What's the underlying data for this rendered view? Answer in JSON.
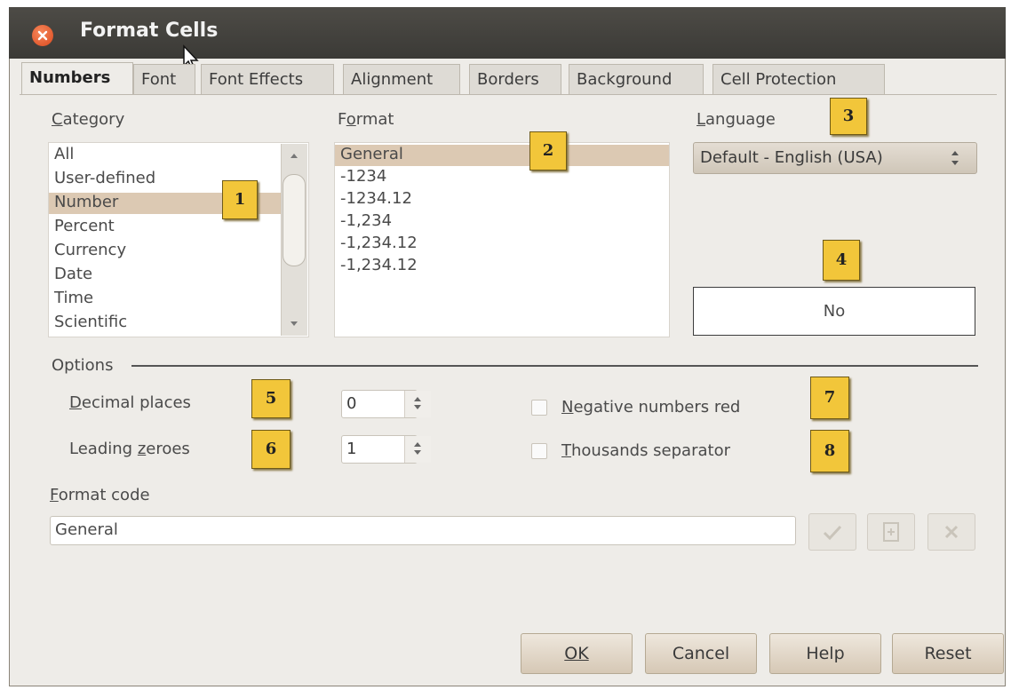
{
  "window": {
    "title": "Format Cells"
  },
  "tabs": [
    {
      "label": "Numbers",
      "active": true
    },
    {
      "label": "Font"
    },
    {
      "label": "Font Effects"
    },
    {
      "label": "Alignment"
    },
    {
      "label": "Borders"
    },
    {
      "label": "Background"
    },
    {
      "label": "Cell Protection"
    }
  ],
  "category": {
    "label": "Category",
    "items": [
      "All",
      "User-defined",
      "Number",
      "Percent",
      "Currency",
      "Date",
      "Time",
      "Scientific"
    ],
    "selected": "Number"
  },
  "format": {
    "label": "Format",
    "items": [
      "General",
      "-1234",
      "-1234.12",
      "-1,234",
      "-1,234.12",
      "-1,234.12"
    ],
    "selected": "General"
  },
  "language": {
    "label": "Language",
    "value": "Default - English (USA)"
  },
  "preview": {
    "value": "No"
  },
  "options": {
    "label": "Options",
    "decimal_places": {
      "label": "Decimal places",
      "value": "0"
    },
    "leading_zeroes": {
      "label": "Leading zeroes",
      "value": "1"
    },
    "negative_red": {
      "label": "Negative numbers red",
      "checked": false
    },
    "thousands_sep": {
      "label": "Thousands separator",
      "checked": false
    }
  },
  "format_code": {
    "label": "Format code",
    "value": "General"
  },
  "markers": [
    "1",
    "2",
    "3",
    "4",
    "5",
    "6",
    "7",
    "8"
  ],
  "buttons": {
    "ok": "OK",
    "cancel": "Cancel",
    "help": "Help",
    "reset": "Reset"
  },
  "icons": [
    "close-icon",
    "mouse-cursor-icon",
    "checkmark-icon",
    "add-format-icon",
    "remove-format-icon",
    "spin-up-icon",
    "spin-down-icon"
  ],
  "colors": {
    "titlebar": "#3b3a36",
    "dialog": "#eeece8",
    "selection": "#dcc9b3",
    "marker": "#f2c63a",
    "close": "#d9491e"
  }
}
